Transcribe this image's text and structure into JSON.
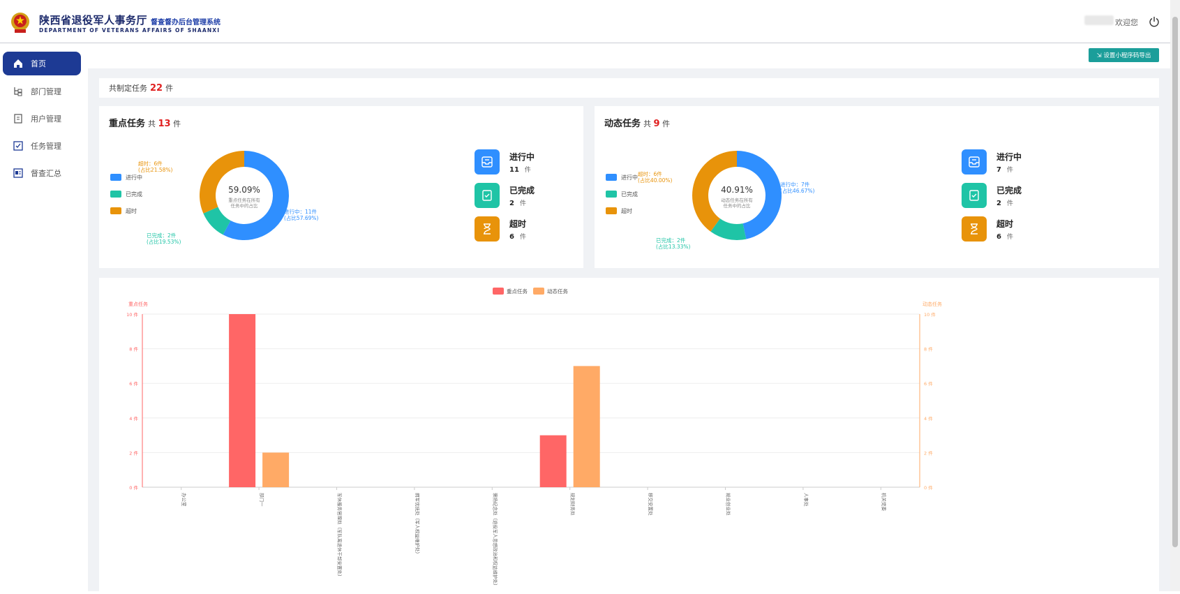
{
  "header": {
    "title": "陕西省退役军人事务厅",
    "subtitle": "督查督办后台管理系统",
    "english": "DEPARTMENT OF VETERANS AFFAIRS OF SHAANXI",
    "welcome": "欢迎您"
  },
  "sidebar": {
    "items": [
      {
        "label": "首页",
        "icon": "home-icon"
      },
      {
        "label": "部门管理",
        "icon": "org-tree-icon"
      },
      {
        "label": "用户管理",
        "icon": "user-doc-icon"
      },
      {
        "label": "任务管理",
        "icon": "checkbox-icon"
      },
      {
        "label": "督查汇总",
        "icon": "summary-icon"
      }
    ]
  },
  "toolbar": {
    "export_label": "⇲ 设置小程序码导出"
  },
  "summary": {
    "prefix": "共制定任务",
    "count": "22",
    "suffix": "件"
  },
  "key_tasks": {
    "title": "重点任务",
    "total_prefix": "共",
    "total": "13",
    "total_suffix": "件",
    "center_percent": "59.09%",
    "center_line1": "重点任务在所有",
    "center_line2": "任务中的占比",
    "legend": [
      "进行中",
      "已完成",
      "超时"
    ],
    "label_progress_1": "进行中：11件",
    "label_progress_2": "(占比57.69%)",
    "label_done_1": "已完成：2件",
    "label_done_2": "(占比19.53%)",
    "label_over_1": "超时：6件",
    "label_over_2": "(占比21.58%)",
    "stats": [
      {
        "label": "进行中",
        "value": "11",
        "unit": "件",
        "color": "#2f8fff"
      },
      {
        "label": "已完成",
        "value": "2",
        "unit": "件",
        "color": "#1fc4a6"
      },
      {
        "label": "超时",
        "value": "6",
        "unit": "件",
        "color": "#e8930a"
      }
    ]
  },
  "dynamic_tasks": {
    "title": "动态任务",
    "total_prefix": "共",
    "total": "9",
    "total_suffix": "件",
    "center_percent": "40.91%",
    "center_line1": "动态任务在所有",
    "center_line2": "任务中的占比",
    "legend": [
      "进行中",
      "已完成",
      "超时"
    ],
    "label_progress_1": "进行中：7件",
    "label_progress_2": "(占比46.67%)",
    "label_done_1": "已完成：2件",
    "label_done_2": "(占比13.33%)",
    "label_over_1": "超时：6件",
    "label_over_2": "(占比40.00%)",
    "stats": [
      {
        "label": "进行中",
        "value": "7",
        "unit": "件",
        "color": "#2f8fff"
      },
      {
        "label": "已完成",
        "value": "2",
        "unit": "件",
        "color": "#1fc4a6"
      },
      {
        "label": "超时",
        "value": "6",
        "unit": "件",
        "color": "#e8930a"
      }
    ]
  },
  "colors": {
    "progress": "#2f8fff",
    "done": "#1fc4a6",
    "overtime": "#e8930a",
    "key": "#ff6666",
    "dynamic": "#ffaa66"
  },
  "chart_data": [
    {
      "type": "pie",
      "title": "重点任务",
      "categories": [
        "进行中",
        "已完成",
        "超时"
      ],
      "values": [
        11,
        2,
        6
      ],
      "inner_radius": "donut"
    },
    {
      "type": "pie",
      "title": "动态任务",
      "categories": [
        "进行中",
        "已完成",
        "超时"
      ],
      "values": [
        7,
        2,
        6
      ],
      "inner_radius": "donut"
    },
    {
      "type": "bar",
      "legend": [
        "重点任务",
        "动态任务"
      ],
      "legend_position": "top-center",
      "ylabel_left": "重点任务",
      "ylabel_right": "动态任务",
      "ylim": [
        0,
        10
      ],
      "yticks": [
        "0 件",
        "2 件",
        "4 件",
        "6 件",
        "8 件",
        "10 件"
      ],
      "categories": [
        "办公室",
        "部门一",
        "军休服务管理处（军队离退休干部安置处）",
        "拥军优抚处（军人权益维护处）",
        "褒扬纪念处（退役军人思想政治和权益维护处）",
        "规划财务处",
        "移交安置处",
        "就业创业处",
        "人事处",
        "机关党委"
      ],
      "series": [
        {
          "name": "重点任务",
          "values": [
            0,
            10,
            0,
            0,
            0,
            3,
            0,
            0,
            0,
            0
          ]
        },
        {
          "name": "动态任务",
          "values": [
            0,
            2,
            0,
            0,
            0,
            7,
            0,
            0,
            0,
            0
          ]
        }
      ]
    }
  ]
}
